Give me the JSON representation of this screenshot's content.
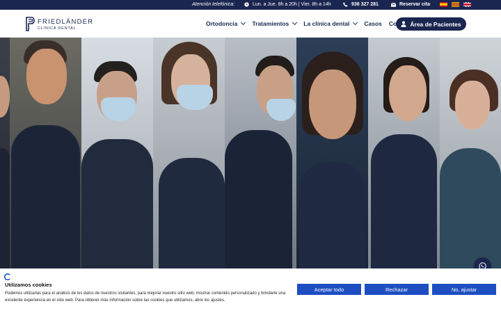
{
  "topbar": {
    "attention_label": "Atención telefónica:",
    "hours": "Lun. a Jue. 8h a 20h | Vier. 8h a 14h",
    "phone": "938 327 281",
    "appointment": "Reservar cita",
    "languages": [
      "es",
      "ca",
      "en"
    ]
  },
  "header": {
    "logo_name": "FRIEDLÄNDER",
    "logo_sub": "CLÍNICA DENTAL",
    "nav": [
      {
        "label": "Ortodoncia",
        "dropdown": true
      },
      {
        "label": "Tratamientos",
        "dropdown": true
      },
      {
        "label": "La clínica dental",
        "dropdown": true
      },
      {
        "label": "Casos",
        "dropdown": false
      },
      {
        "label": "Consejos",
        "dropdown": false
      }
    ],
    "patients_button": "Área de Pacientes"
  },
  "colors": {
    "brand_navy": "#1b2650",
    "cookie_button": "#1e4fc2"
  },
  "cookie": {
    "title": "Utilizamos cookies",
    "text": "Podemos utilizarlas para el análisis de los datos de nuestros visitantes, para mejorar nuestro sitio web, mostrar contenido personalizado y brindarle una excelente experiencia en el sitio web. Para obtener más información sobre las cookies que utilizamos, abre los ajustes.",
    "accept": "Aceptar todo",
    "reject": "Rechazar",
    "adjust": "No, ajustar"
  },
  "icons": {
    "clock": "clock-icon",
    "phone": "phone-icon",
    "mail": "mail-icon",
    "user": "user-icon",
    "whatsapp": "whatsapp-icon",
    "cookie": "cookie-icon"
  }
}
